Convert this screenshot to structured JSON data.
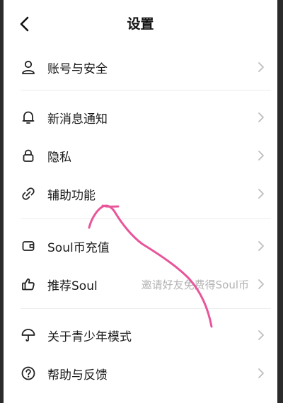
{
  "header": {
    "title": "设置"
  },
  "items": [
    {
      "label": "账号与安全",
      "icon": "user-icon"
    },
    {
      "label": "新消息通知",
      "icon": "bell-icon"
    },
    {
      "label": "隐私",
      "icon": "lock-icon"
    },
    {
      "label": "辅助功能",
      "icon": "link-icon"
    },
    {
      "label": "Soul币充值",
      "icon": "wallet-icon"
    },
    {
      "label": "推荐Soul",
      "icon": "thumbs-up-icon",
      "hint": "邀请好友免费得Soul币"
    },
    {
      "label": "关于青少年模式",
      "icon": "umbrella-icon"
    },
    {
      "label": "帮助与反馈",
      "icon": "help-icon"
    }
  ],
  "annotation": {
    "color": "#e8559a"
  }
}
